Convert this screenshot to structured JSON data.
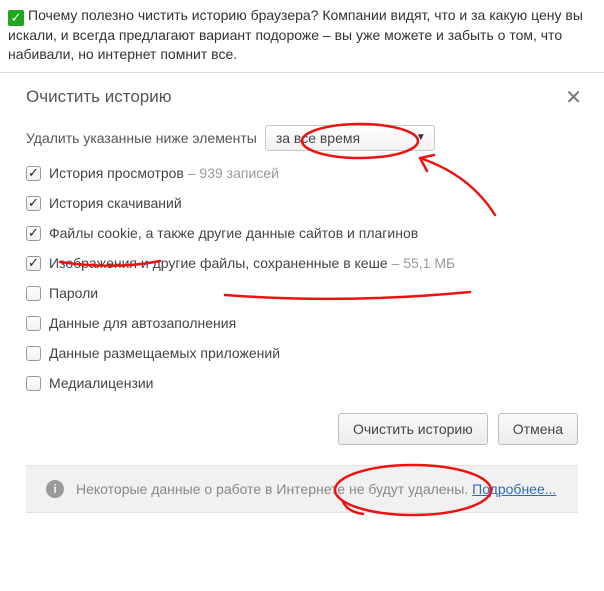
{
  "note": {
    "text": "Почему полезно чистить историю браузера? Компании видят, что и за какую цену вы искали, и всегда предлагают вариант подороже – вы уже можете и забыть о том, что набивали, но интернет помнит все."
  },
  "dialog": {
    "title": "Очистить историю",
    "select_label": "Удалить указанные ниже элементы",
    "select_value": "за все время",
    "options": [
      {
        "label": "История просмотров",
        "suffix": " – 939 записей",
        "checked": true
      },
      {
        "label": "История скачиваний",
        "suffix": "",
        "checked": true
      },
      {
        "label": "Файлы cookie, а также другие данные сайтов и плагинов",
        "suffix": "",
        "checked": true
      },
      {
        "label": "Изображения и другие файлы, сохраненные в кеше",
        "suffix": " – 55,1 МБ",
        "checked": true
      },
      {
        "label": "Пароли",
        "suffix": "",
        "checked": false
      },
      {
        "label": "Данные для автозаполнения",
        "suffix": "",
        "checked": false
      },
      {
        "label": "Данные размещаемых приложений",
        "suffix": "",
        "checked": false
      },
      {
        "label": "Медиалицензии",
        "suffix": "",
        "checked": false
      }
    ],
    "buttons": {
      "clear": "Очистить историю",
      "cancel": "Отмена"
    },
    "footer": {
      "text": "Некоторые данные о работе в Интернете не будут удалены.",
      "link": "Подробнее..."
    }
  }
}
